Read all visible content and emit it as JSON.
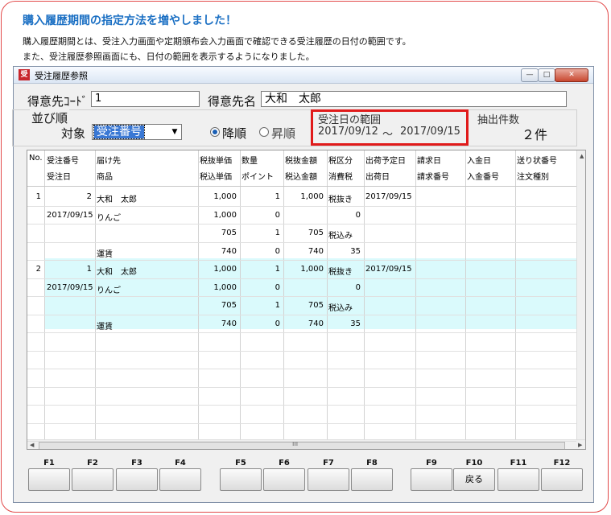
{
  "notice": {
    "headline": "購入履歴期間の指定方法を増やしました！",
    "line1": "購入履歴期間とは、受注入力画面や定期頒布会入力画面で確認できる受注履歴の日付の範囲です。",
    "line2": "また、受注履歴参照画面にも、日付の範囲を表示するようになりました。"
  },
  "window": {
    "title": "受注履歴参照",
    "icon": "app-icon",
    "controls": {
      "min": "—",
      "max": "□",
      "close": "✕"
    }
  },
  "form": {
    "customer_code_label": "得意先ｺｰﾄﾞ",
    "customer_code_value": "1",
    "customer_name_label": "得意先名",
    "customer_name_value": "大和　太郎",
    "sort_group_label": "並び順",
    "target_label": "対象",
    "target_value": "受注番号",
    "radio_desc_label": "降順",
    "radio_asc_label": "昇順",
    "range_label": "受注日の範囲",
    "range_from": "2017/09/12",
    "range_sep": "～",
    "range_to": "2017/09/15",
    "count_label": "抽出件数",
    "count_value": "２件"
  },
  "grid": {
    "headers1": [
      "No.",
      "受注番号",
      "届け先",
      "税抜単価",
      "数量",
      "税抜金額",
      "税区分",
      "出荷予定日",
      "請求日",
      "入金日",
      "送り状番号"
    ],
    "headers2": [
      "",
      "受注日",
      "商品",
      "税込単価",
      "ポイント",
      "税込金額",
      "消費税",
      "出荷日",
      "請求番号",
      "入金番号",
      "注文種別"
    ],
    "rows": [
      [
        "1",
        "2",
        "大和　太郎",
        "1,000",
        "1",
        "1,000",
        "税抜き",
        "2017/09/15",
        "",
        "",
        ""
      ],
      [
        "",
        "2017/09/15",
        "りんご",
        "1,000",
        "0",
        "",
        "0",
        "",
        "",
        "",
        ""
      ],
      [
        "",
        "",
        "",
        "705",
        "1",
        "705",
        "税込み",
        "",
        "",
        "",
        ""
      ],
      [
        "",
        "",
        "運賃",
        "740",
        "0",
        "740",
        "35",
        "",
        "",
        "",
        ""
      ],
      [
        "2",
        "1",
        "大和　太郎",
        "1,000",
        "1",
        "1,000",
        "税抜き",
        "2017/09/15",
        "",
        "",
        ""
      ],
      [
        "",
        "2017/09/15",
        "りんご",
        "1,000",
        "0",
        "",
        "0",
        "",
        "",
        "",
        ""
      ],
      [
        "",
        "",
        "",
        "705",
        "1",
        "705",
        "税込み",
        "",
        "",
        "",
        ""
      ],
      [
        "",
        "",
        "運賃",
        "740",
        "0",
        "740",
        "35",
        "",
        "",
        "",
        ""
      ]
    ],
    "scroll_grip": "III"
  },
  "fkeys": {
    "labels": [
      "F1",
      "F2",
      "F3",
      "F4",
      "F5",
      "F6",
      "F7",
      "F8",
      "F9",
      "F10",
      "F11",
      "F12"
    ],
    "buttons": [
      "",
      "",
      "",
      "",
      "",
      "",
      "",
      "",
      "",
      "戻る",
      "",
      ""
    ]
  },
  "colors": {
    "accent": "#1a6fc3",
    "highlight_box": "#e01a1a",
    "selected_row": "#dafafc"
  }
}
